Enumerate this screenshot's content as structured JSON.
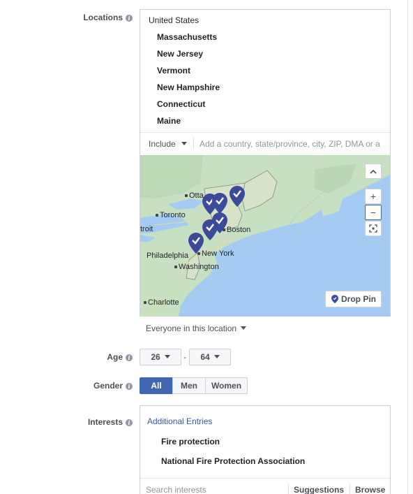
{
  "locations": {
    "label": "Locations",
    "country": "United States",
    "items": [
      "Massachusetts",
      "New Jersey",
      "Vermont",
      "New Hampshire",
      "Connecticut",
      "Maine"
    ],
    "include_label": "Include",
    "input_placeholder": "Add a country, state/province, city, ZIP, DMA or a",
    "map": {
      "labels": {
        "ottawa": "Otta",
        "toronto": "Toronto",
        "detroit": "troit",
        "boston": "Boston",
        "new_york": "New York",
        "philadelphia": "Philadelphia",
        "washington": "Washington",
        "charlotte": "Charlotte"
      },
      "drop_pin_label": "Drop Pin",
      "zoom_in_label": "+",
      "zoom_out_label": "−",
      "pin_color": "#3b4a99"
    },
    "audience_label": "Everyone in this location"
  },
  "age": {
    "label": "Age",
    "min": "26",
    "separator": "-",
    "max": "64"
  },
  "gender": {
    "label": "Gender",
    "options": [
      "All",
      "Men",
      "Women"
    ],
    "selected": "All",
    "accent": "#4267b2"
  },
  "interests": {
    "label": "Interests",
    "additional_entries": "Additional Entries",
    "items": [
      "Fire protection",
      "National Fire Protection Association"
    ],
    "search_placeholder": "Search interests",
    "suggestions_label": "Suggestions",
    "browse_label": "Browse"
  }
}
